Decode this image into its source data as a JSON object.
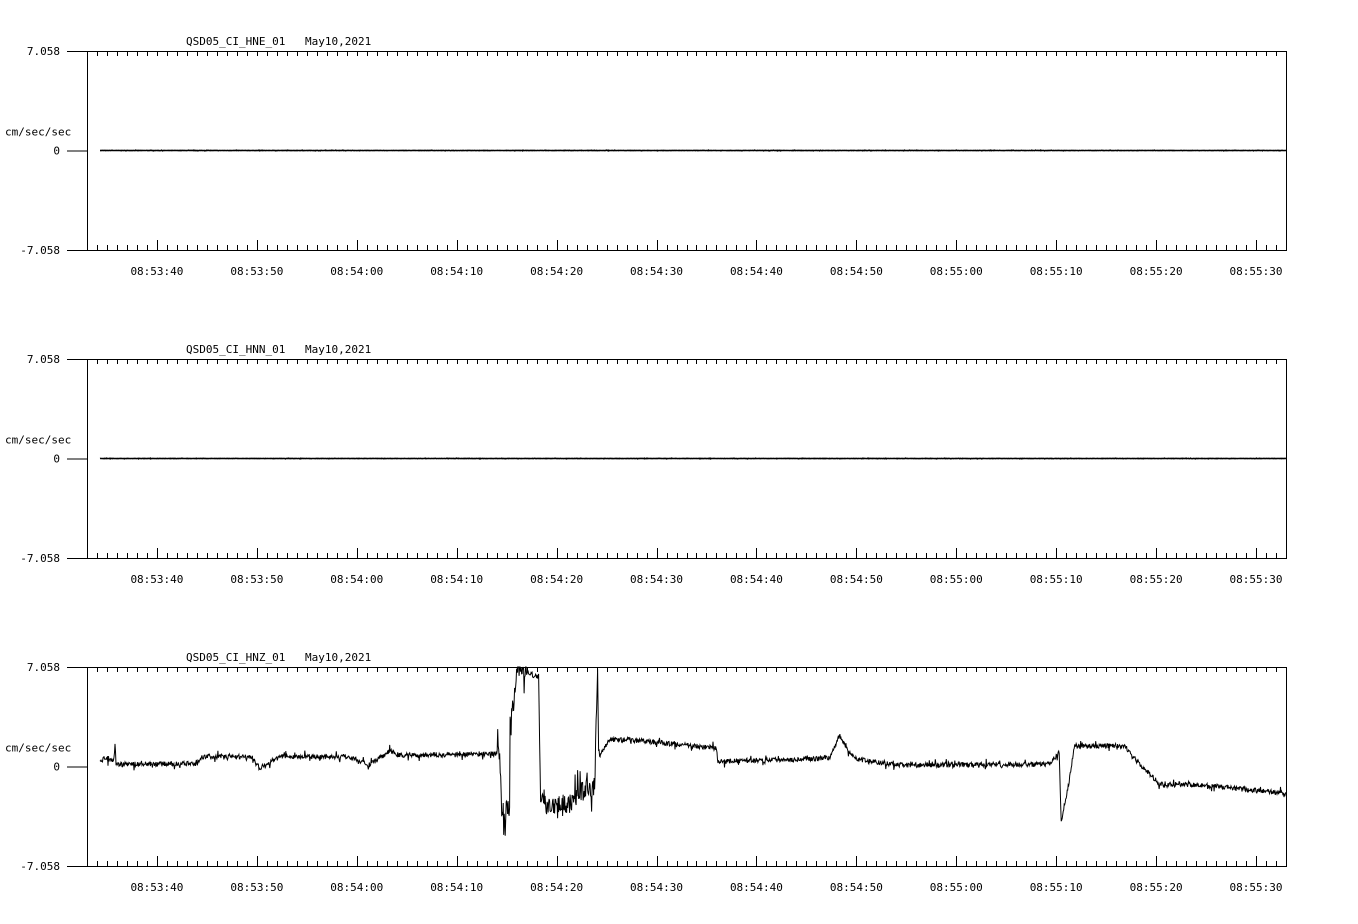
{
  "chart_data": [
    {
      "type": "line",
      "title": "QSD05_CI_HNE_01",
      "date": "May10,2021",
      "ylabel": "cm/sec/sec",
      "ylim": [
        -7.058,
        7.058
      ],
      "ytick_labels": [
        "7.058",
        "0",
        "-7.058"
      ],
      "x_start": "08:53:33",
      "x_range_seconds": [
        0,
        120
      ],
      "xtick_labels": [
        "08:53:40",
        "08:53:50",
        "08:54:00",
        "08:54:10",
        "08:54:20",
        "08:54:30",
        "08:54:40",
        "08:54:50",
        "08:55:00",
        "08:55:10",
        "08:55:20",
        "08:55:30"
      ],
      "series": [
        {
          "name": "HNE",
          "t": [
            1.3,
            120
          ],
          "values": [
            0,
            0
          ],
          "noise": 0.02
        }
      ]
    },
    {
      "type": "line",
      "title": "QSD05_CI_HNN_01",
      "date": "May10,2021",
      "ylabel": "cm/sec/sec",
      "ylim": [
        -7.058,
        7.058
      ],
      "ytick_labels": [
        "7.058",
        "0",
        "-7.058"
      ],
      "x_start": "08:53:33",
      "x_range_seconds": [
        0,
        120
      ],
      "xtick_labels": [
        "08:53:40",
        "08:53:50",
        "08:54:00",
        "08:54:10",
        "08:54:20",
        "08:54:30",
        "08:54:40",
        "08:54:50",
        "08:55:00",
        "08:55:10",
        "08:55:20",
        "08:55:30"
      ],
      "series": [
        {
          "name": "HNN",
          "t": [
            1.3,
            120
          ],
          "values": [
            0,
            0
          ],
          "noise": 0.02
        }
      ]
    },
    {
      "type": "line",
      "title": "QSD05_CI_HNZ_01",
      "date": "May10,2021",
      "ylabel": "cm/sec/sec",
      "ylim": [
        -7.058,
        7.058
      ],
      "ytick_labels": [
        "7.058",
        "0",
        "-7.058"
      ],
      "x_start": "08:53:33",
      "x_range_seconds": [
        0,
        120
      ],
      "xtick_labels": [
        "08:53:40",
        "08:53:50",
        "08:54:00",
        "08:54:10",
        "08:54:20",
        "08:54:30",
        "08:54:40",
        "08:54:50",
        "08:55:00",
        "08:55:10",
        "08:55:20",
        "08:55:30"
      ],
      "series": [
        {
          "name": "HNZ",
          "t": [
            1.3,
            2.7,
            2.8,
            2.9,
            3.3,
            11.0,
            11.5,
            16.5,
            17.3,
            19.3,
            26.3,
            28.3,
            30.3,
            31.3,
            40.8,
            41.3,
            41.5,
            42.3,
            41.8,
            40.8,
            41.3,
            41.8,
            42.3,
            42.8,
            43.0,
            45.2,
            45.4,
            45.8,
            48.3,
            49.3,
            50.8,
            51.1,
            51.2,
            51.3,
            52.3,
            54.3,
            63.0,
            63.1,
            74.3,
            75.3,
            76.3,
            76.8,
            78.3,
            81.3,
            96.3,
            97.3,
            97.5,
            98.3,
            98.8,
            103.8,
            105.3,
            107.3,
            111.3,
            120.0
          ],
          "values": [
            0.45,
            0.5,
            1.6,
            0.3,
            0.15,
            0.2,
            0.7,
            0.7,
            -0.1,
            0.7,
            0.7,
            0.1,
            1.1,
            0.8,
            0.9,
            1.2,
            -3.7,
            -2.8,
            -3.5,
            -3.7,
            0.1,
            2.5,
            2.6,
            5.0,
            7.0,
            6.3,
            -2.4,
            -2.7,
            -2.6,
            -1.8,
            -1.5,
            7.0,
            1.2,
            0.8,
            1.9,
            1.9,
            1.3,
            0.35,
            0.6,
            2.2,
            1.0,
            0.6,
            0.35,
            0.1,
            0.15,
            1.0,
            -3.9,
            -1.0,
            1.4,
            1.5,
            0.2,
            -1.2,
            -1.3,
            -1.9
          ],
          "noise": 0.35
        }
      ]
    }
  ]
}
